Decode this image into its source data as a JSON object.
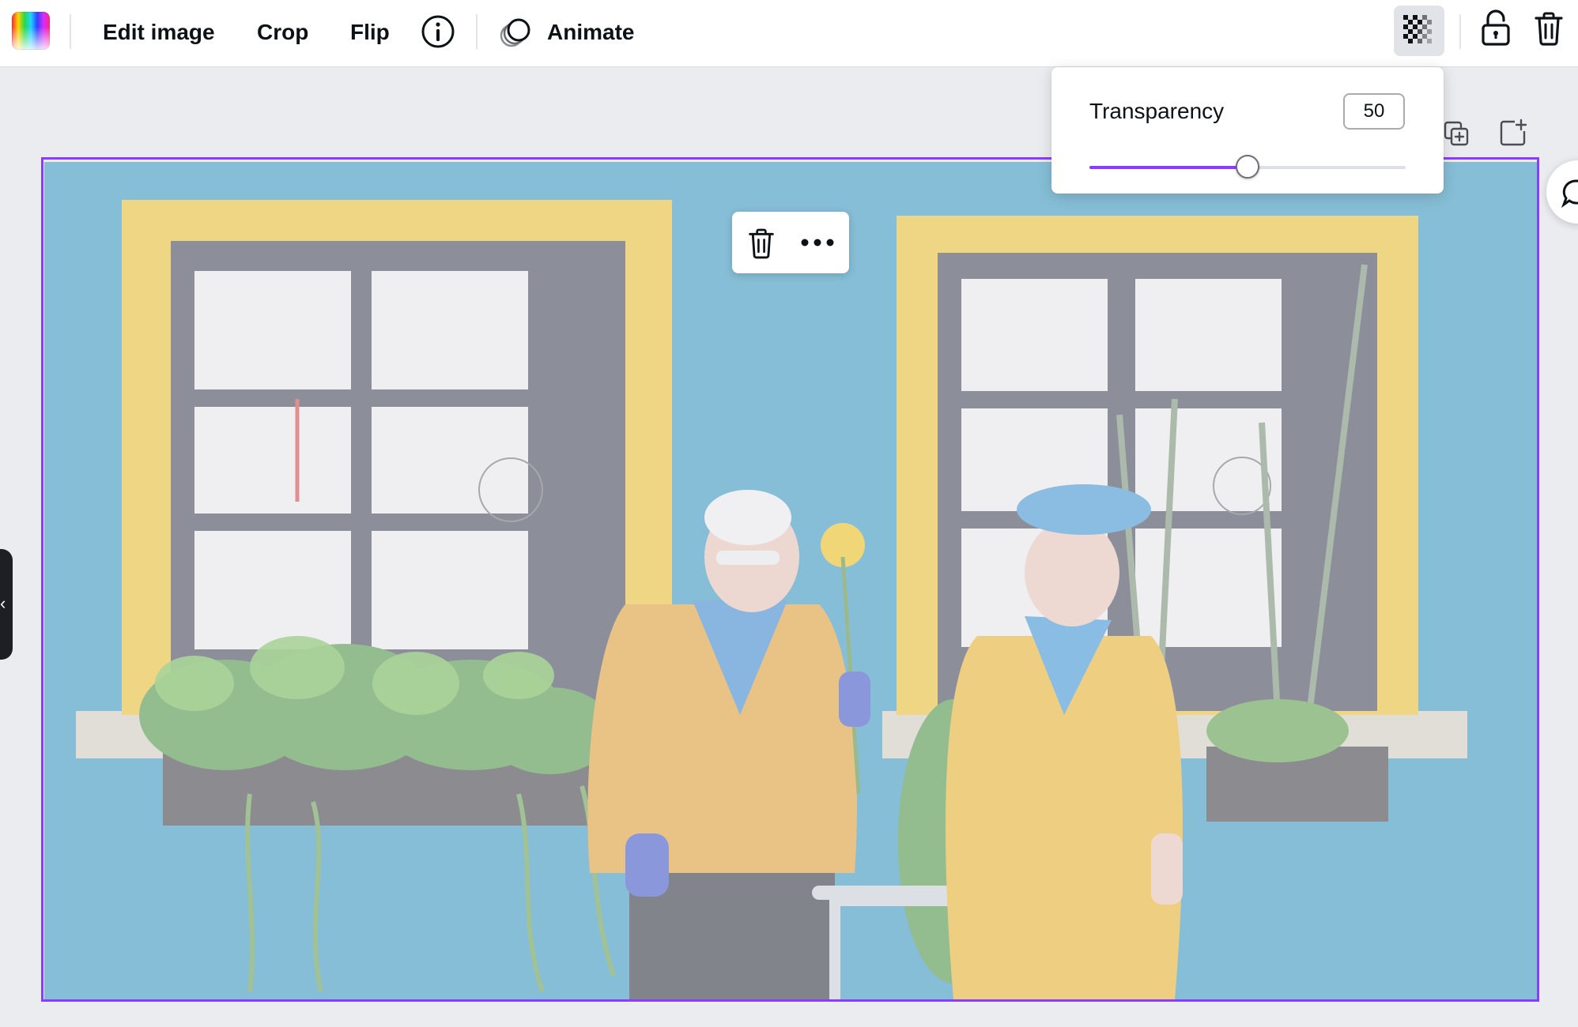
{
  "toolbar": {
    "color_swatch": "color-picker",
    "edit_image": "Edit image",
    "crop": "Crop",
    "flip": "Flip",
    "info_icon": "info-icon",
    "animate": "Animate",
    "transparency_icon": "transparency-checker-icon",
    "lock_icon": "unlock-icon",
    "delete_icon": "trash-icon"
  },
  "transparency_popover": {
    "label": "Transparency",
    "value": "50",
    "slider_percent": 50,
    "accent_color": "#8b3dff"
  },
  "canvas_actions": {
    "duplicate_icon": "duplicate-page-icon",
    "add_page_icon": "add-page-icon",
    "comment_icon": "comment-icon"
  },
  "floating_menu": {
    "delete_icon": "trash-icon",
    "more_icon": "more-dots-icon"
  },
  "side_tab": {
    "glyph": "‹"
  },
  "colors": {
    "selection": "#8b3dff",
    "canvas_bg": "#ebecf0",
    "wall": "#4aa7c9",
    "frame_yellow": "#f2d25a"
  }
}
